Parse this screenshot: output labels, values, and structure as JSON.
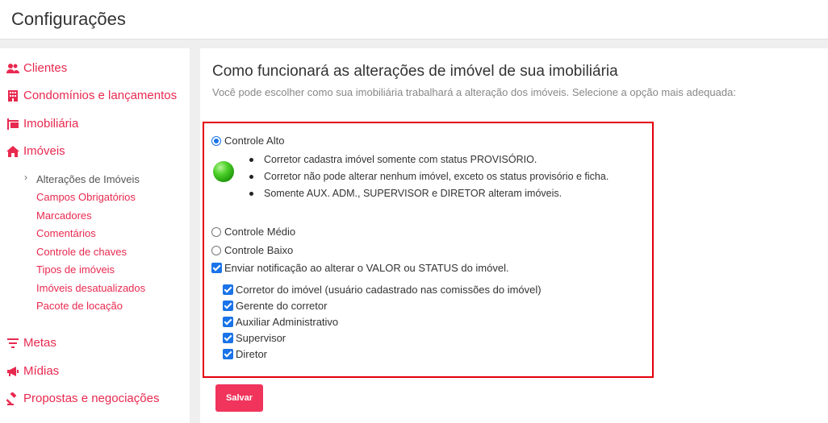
{
  "header": {
    "title": "Configurações"
  },
  "sidebar": {
    "items": [
      {
        "label": "Clientes",
        "icon": "users-icon"
      },
      {
        "label": "Condomínios e lançamentos",
        "icon": "building-icon"
      },
      {
        "label": "Imobiliária",
        "icon": "sign-icon"
      },
      {
        "label": "Imóveis",
        "icon": "home-icon"
      },
      {
        "label": "Metas",
        "icon": "filter-icon"
      },
      {
        "label": "Mídias",
        "icon": "megaphone-icon"
      },
      {
        "label": "Propostas e negociações",
        "icon": "gavel-icon"
      }
    ],
    "subitems": [
      "Alterações de Imóveis",
      "Campos Obrigatórios",
      "Marcadores",
      "Comentários",
      "Controle de chaves",
      "Tipos de imóveis",
      "Imóveis desatualizados",
      "Pacote de locação"
    ]
  },
  "main": {
    "title": "Como funcionará as alterações de imóvel de sua imobiliária",
    "subtitle": "Você pode escolher como sua imobiliária trabalhará a alteração dos imóveis. Selecione a opção mais adequada:",
    "options": {
      "high": "Controle Alto",
      "medium": "Controle Médio",
      "low": "Controle Baixo"
    },
    "selected_option": "Controle Alto",
    "bullets": [
      "Corretor cadastra imóvel somente com status PROVISÓRIO.",
      "Corretor não pode alterar nenhum imóvel, exceto os status provisório e ficha.",
      "Somente AUX. ADM., SUPERVISOR e DIRETOR alteram imóveis."
    ],
    "notify_label": "Enviar notificação ao alterar o VALOR ou STATUS do imóvel.",
    "notify_checked": true,
    "recipients": [
      "Corretor do imóvel (usuário cadastrado nas comissões do imóvel)",
      "Gerente do corretor",
      "Auxiliar Administrativo",
      "Supervisor",
      "Diretor"
    ],
    "save_label": "Salvar"
  },
  "colors": {
    "accent": "#e8294f",
    "highlight_border": "#e3000b",
    "button": "#f0345c",
    "check": "#1a73e8",
    "status_green": "#2fb81a"
  }
}
